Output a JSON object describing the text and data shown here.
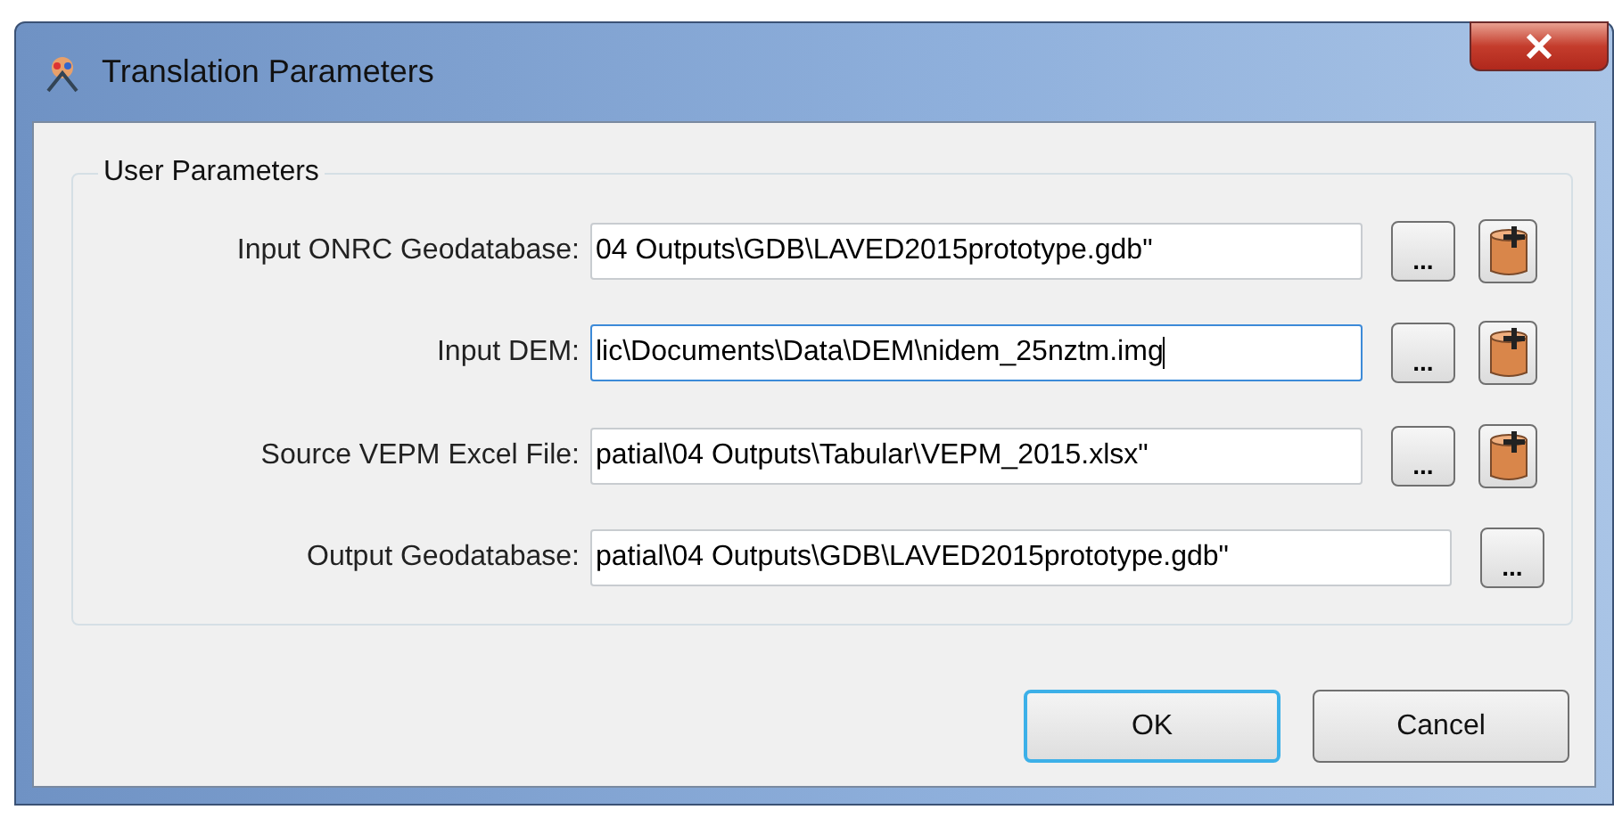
{
  "window": {
    "title": "Translation Parameters"
  },
  "group": {
    "title": "User Parameters"
  },
  "parameters": [
    {
      "label": "Input ONRC Geodatabase:",
      "value": "04 Outputs\\GDB\\LAVED2015prototype.gdb\"",
      "focused": false,
      "add_button": true
    },
    {
      "label": "Input DEM:",
      "value": "lic\\Documents\\Data\\DEM\\nidem_25nztm.img",
      "focused": true,
      "add_button": true
    },
    {
      "label": "Source VEPM Excel File:",
      "value": "patial\\04 Outputs\\Tabular\\VEPM_2015.xlsx\"",
      "focused": false,
      "add_button": true
    },
    {
      "label": "Output Geodatabase:",
      "value": "patial\\04 Outputs\\GDB\\LAVED2015prototype.gdb\"",
      "focused": false,
      "add_button": false
    }
  ],
  "browse_label": "...",
  "buttons": [
    {
      "label": "OK",
      "default": true
    },
    {
      "label": "Cancel",
      "default": false
    }
  ]
}
